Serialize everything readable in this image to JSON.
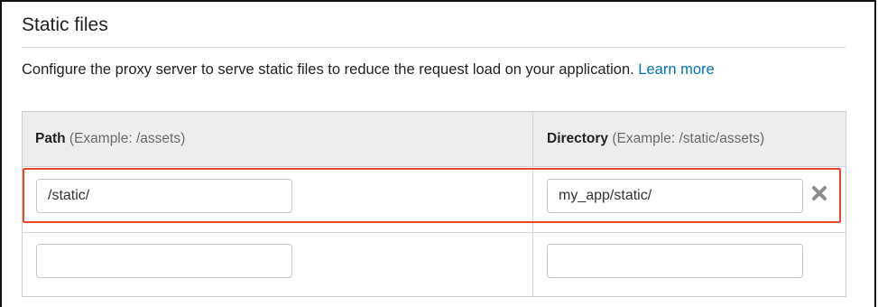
{
  "section": {
    "title": "Static files",
    "description": "Configure the proxy server to serve static files to reduce the request load on your application.",
    "learn_more_label": "Learn more"
  },
  "table": {
    "columns": [
      {
        "name": "Path",
        "hint": "(Example: /assets)"
      },
      {
        "name": "Directory",
        "hint": "(Example: /static/assets)"
      }
    ],
    "rows": [
      {
        "path": "/static/",
        "directory": "my_app/static/",
        "remove_icon": "close-x-icon",
        "highlighted": true
      },
      {
        "path": "",
        "directory": ""
      }
    ]
  },
  "colors": {
    "link": "#0073bb",
    "highlight_border": "#e8472b",
    "header_background": "#ededed"
  }
}
